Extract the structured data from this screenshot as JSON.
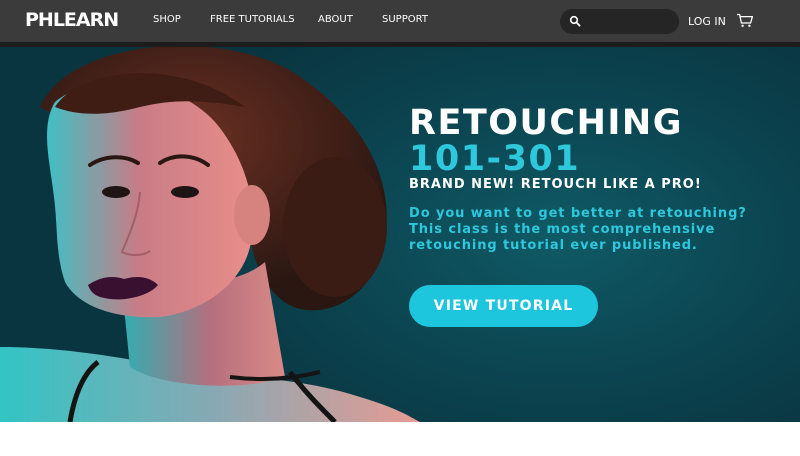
{
  "nav": {
    "logo": "PHLEARN",
    "links": [
      {
        "label": "SHOP"
      },
      {
        "label": "FREE TUTORIALS"
      },
      {
        "label": "ABOUT"
      },
      {
        "label": "SUPPORT"
      }
    ],
    "search": {
      "value": "",
      "placeholder": ""
    },
    "login_label": "LOG IN",
    "icons": {
      "search": "search-icon",
      "cart": "cart-icon"
    }
  },
  "hero": {
    "title": "RETOUCHING",
    "title_accent": "101-301",
    "subtitle": "BRAND NEW! RETOUCH LIKE A PRO!",
    "description_lines": [
      "Do you want to get better at retouching?",
      "This class is the most comprehensive",
      "retouching tutorial ever published."
    ],
    "cta_label": "VIEW TUTORIAL",
    "slides": {
      "count": 2,
      "active": 1
    }
  },
  "colors": {
    "nav_bg": "#3b3b3b",
    "accent": "#2ec8dc",
    "button": "#1ec6dd",
    "hero_bg": "#0b4450"
  }
}
